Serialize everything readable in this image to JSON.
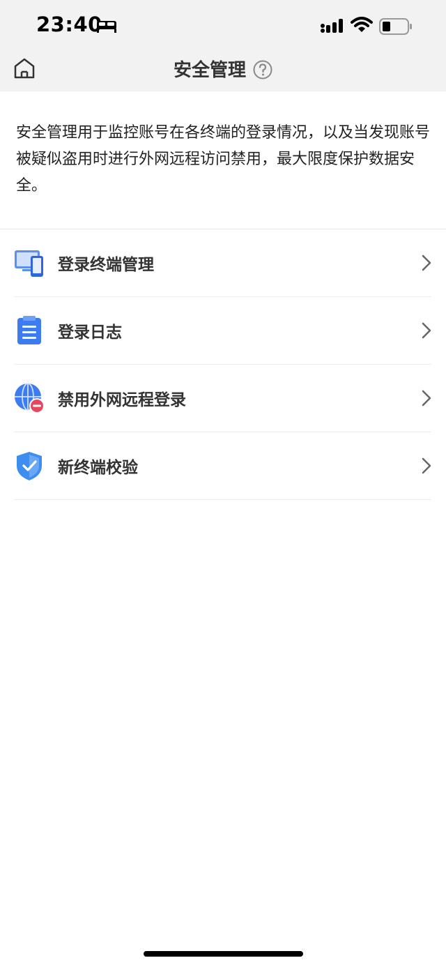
{
  "status_bar": {
    "time": "23:40",
    "icons": [
      "bed-icon",
      "cellular-signal-icon",
      "wifi-icon",
      "battery-icon"
    ]
  },
  "nav": {
    "title": "安全管理",
    "left_icon": "home-icon",
    "title_icon": "help-icon"
  },
  "description": "安全管理用于监控账号在各终端的登录情况，以及当发现账号被疑似盗用时进行外网远程访问禁用，最大限度保护数据安全。",
  "menu": {
    "items": [
      {
        "label": "登录终端管理",
        "icon": "devices-icon"
      },
      {
        "label": "登录日志",
        "icon": "clipboard-icon"
      },
      {
        "label": "禁用外网远程登录",
        "icon": "globe-block-icon"
      },
      {
        "label": "新终端校验",
        "icon": "shield-check-icon"
      }
    ]
  },
  "colors": {
    "header_background": "#f2f2f2",
    "icon_blue": "#3d7bf0",
    "block_red": "#e8455e"
  }
}
